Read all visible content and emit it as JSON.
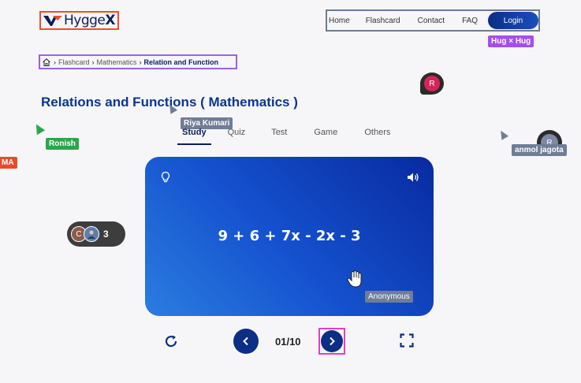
{
  "header": {
    "logo_prefix": "Hygge",
    "logo_suffix": "X",
    "nav": [
      "Home",
      "Flashcard",
      "Contact",
      "FAQ"
    ],
    "login_label": "Login"
  },
  "collab_tags": {
    "hug": "Hug × Hug",
    "riya": "Riya Kumari",
    "ronish": "Ronish",
    "ma": "MA",
    "anmol": "anmol jagota",
    "anonymous": "Anonymous"
  },
  "avatars": {
    "r_initial": "R",
    "a_initial": "R",
    "presence_initial": "C",
    "presence_count": "3"
  },
  "breadcrumb": {
    "items": [
      "Flashcard",
      "Mathematics",
      "Relation and Function"
    ]
  },
  "page_title": "Relations and Functions ( Mathematics )",
  "tabs": [
    "Study",
    "Quiz",
    "Test",
    "Game",
    "Others"
  ],
  "card": {
    "expression": "9 + 6 + 7x - 2x - 3"
  },
  "controls": {
    "counter": "01/10"
  },
  "colors": {
    "brand_navy": "#0b2e86",
    "title_blue": "#0b3590",
    "card_gradient_start": "#082aa0",
    "card_gradient_end": "#2b7de0"
  }
}
